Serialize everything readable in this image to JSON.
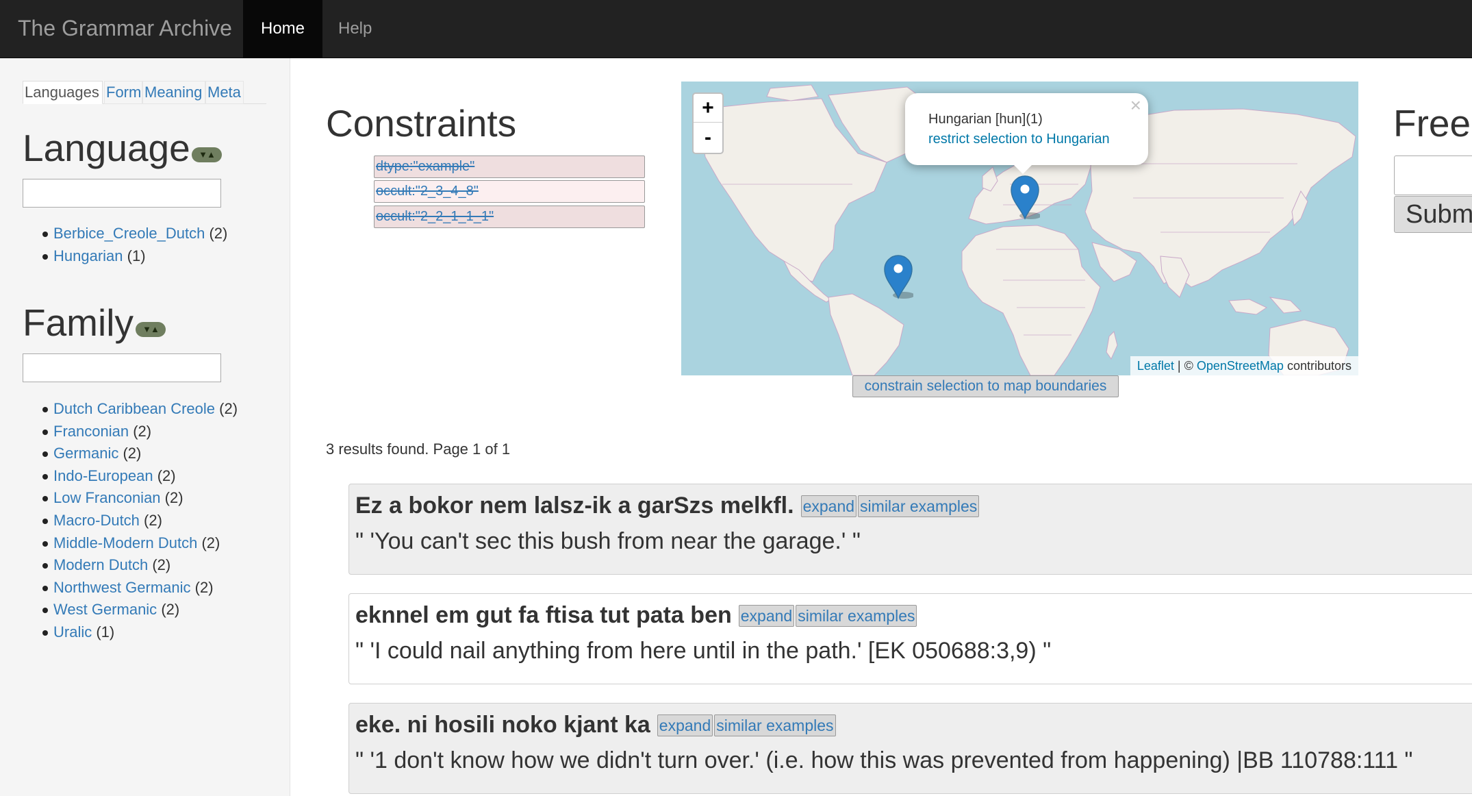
{
  "navbar": {
    "brand": "The Grammar Archive",
    "items": [
      {
        "label": "Home",
        "active": true
      },
      {
        "label": "Help",
        "active": false
      }
    ]
  },
  "sidebar": {
    "tabs": [
      "Languages",
      "Form",
      "Meaning",
      "Meta"
    ],
    "language": {
      "title": "Language",
      "toggle": "▼▲",
      "filter_value": "",
      "items": [
        {
          "label": "Berbice_Creole_Dutch",
          "count": "(2)"
        },
        {
          "label": "Hungarian",
          "count": "(1)"
        }
      ]
    },
    "family": {
      "title": "Family",
      "toggle": "▼▲",
      "filter_value": "",
      "items": [
        {
          "label": "Dutch Caribbean Creole",
          "count": "(2)"
        },
        {
          "label": "Franconian",
          "count": "(2)"
        },
        {
          "label": "Germanic",
          "count": "(2)"
        },
        {
          "label": "Indo-European",
          "count": "(2)"
        },
        {
          "label": "Low Franconian",
          "count": "(2)"
        },
        {
          "label": "Macro-Dutch",
          "count": "(2)"
        },
        {
          "label": "Middle-Modern Dutch",
          "count": "(2)"
        },
        {
          "label": "Modern Dutch",
          "count": "(2)"
        },
        {
          "label": "Northwest Germanic",
          "count": "(2)"
        },
        {
          "label": "West Germanic",
          "count": "(2)"
        },
        {
          "label": "Uralic",
          "count": "(1)"
        }
      ]
    }
  },
  "constraints": {
    "title": "Constraints",
    "items": [
      "dtype:\"example\"",
      "occult:\"2_3_4_8\"",
      "occult:\"2_2_1_1_1\""
    ]
  },
  "map": {
    "zoom_in": "+",
    "zoom_out": "-",
    "popup": {
      "title": "Hungarian [hun](1)",
      "link": "restrict selection to Hungarian",
      "close": "×"
    },
    "attribution": {
      "leaflet": "Leaflet",
      "separator": " | © ",
      "osm": "OpenStreetMap",
      "suffix": " contributors"
    },
    "colors": {
      "water": "#aad3df",
      "land": "#f2efe9",
      "borders": "#c9a8c8",
      "marker": "#2a81cb"
    },
    "constrain_button": "constrain selection to map boundaries"
  },
  "free_search": {
    "title": "Free",
    "input_value": "",
    "submit": "Submi"
  },
  "results": {
    "summary": "3 results found. Page 1 of 1",
    "expand_label": "expand",
    "similar_label": "similar examples",
    "items": [
      {
        "form": "Ez a bokor nem lalsz-ik a garSzs melkfl.",
        "translation": "\" 'You can't sec this bush from near the garage.' \""
      },
      {
        "form": "eknnel em gut fa ftisa tut pata ben",
        "translation": "\" 'I could nail anything from here until in the path.' [EK 050688:3,9) \""
      },
      {
        "form": "eke. ni hosili noko kjant ka",
        "translation": "\" '1 don't know how we didn't turn over.' (i.e. how this was prevented from happening) |BB 110788:111 \""
      }
    ]
  }
}
